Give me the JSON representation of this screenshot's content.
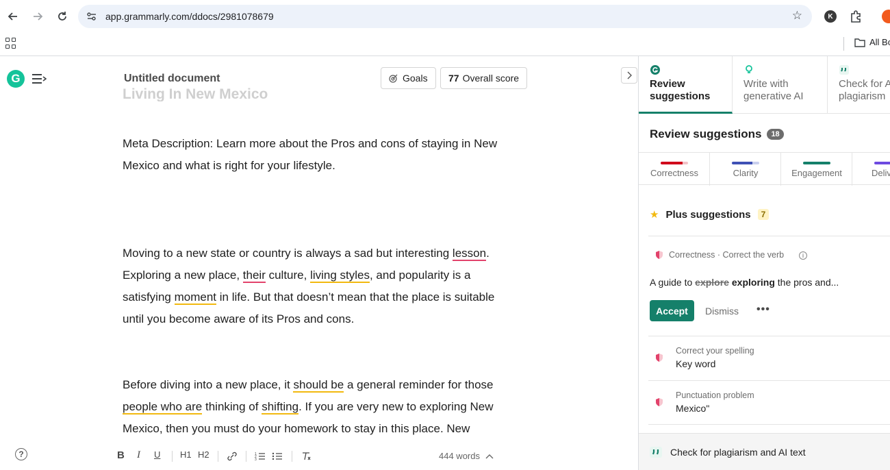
{
  "browser": {
    "url": "app.grammarly.com/ddocs/2981078679",
    "profile_initial": "K",
    "bookmarks_label": "All Bo"
  },
  "editor": {
    "doc_title": "Untitled document",
    "goals_label": "Goals",
    "score_value": "77",
    "score_label": "Overall score",
    "faded_heading": "Living In New Mexico",
    "p1": [
      "Meta Description: Learn more about the Pros and cons of staying in New",
      "Mexico and what is right for your lifestyle."
    ],
    "p2": {
      "l1a": "Moving to a new state or country is always a sad but interesting ",
      "l1b": "lesson",
      "l1c": ".",
      "l2a": "Exploring a new place, ",
      "l2b": "their",
      "l2c": " culture, ",
      "l2d": "living styles",
      "l2e": ", and popularity is a",
      "l3a": "satisfying ",
      "l3b": "moment",
      "l3c": " in life. But that doesn’t mean that the place is suitable",
      "l4": "until you become aware of its Pros and cons."
    },
    "p3": {
      "l1a": "Before diving into a new place, it ",
      "l1b": "should be",
      "l1c": " a general reminder for those",
      "l2a": "people who are",
      "l2b": " thinking of ",
      "l2c": "shifting",
      "l2d": ". If you are very new to exploring New",
      "l3": "Mexico, then you must do your homework to stay in this place. New"
    },
    "toolbar": {
      "bold": "B",
      "italic": "I",
      "underline": "U",
      "h1": "H1",
      "h2": "H2",
      "word_count": "444 words"
    }
  },
  "panel": {
    "tabs": [
      {
        "label": "Review suggestions"
      },
      {
        "label": "Write with generative AI"
      },
      {
        "label": "Check for AI text & plagiarism"
      }
    ],
    "review_title": "Review suggestions",
    "review_count": "18",
    "categories": [
      {
        "label": "Correctness",
        "color": "#d0021b"
      },
      {
        "label": "Clarity",
        "color": "#3f51b5"
      },
      {
        "label": "Engagement",
        "color": "#15806a"
      },
      {
        "label": "Delivery",
        "color": "#6d4ae0"
      }
    ],
    "plus_label": "Plus suggestions",
    "plus_count": "7",
    "active_card": {
      "meta": "Correctness · Correct the verb",
      "text_pre": "A guide to ",
      "text_strike": "explore",
      "text_new": "exploring",
      "text_post": " the pros and...",
      "accept": "Accept",
      "dismiss": "Dismiss",
      "more": "•••"
    },
    "cards": [
      {
        "meta": "Correct your spelling",
        "main": "Key word"
      },
      {
        "meta": "Punctuation problem",
        "main": "Mexico\""
      }
    ],
    "plagiarism_label": "Check for plagiarism and AI text"
  }
}
